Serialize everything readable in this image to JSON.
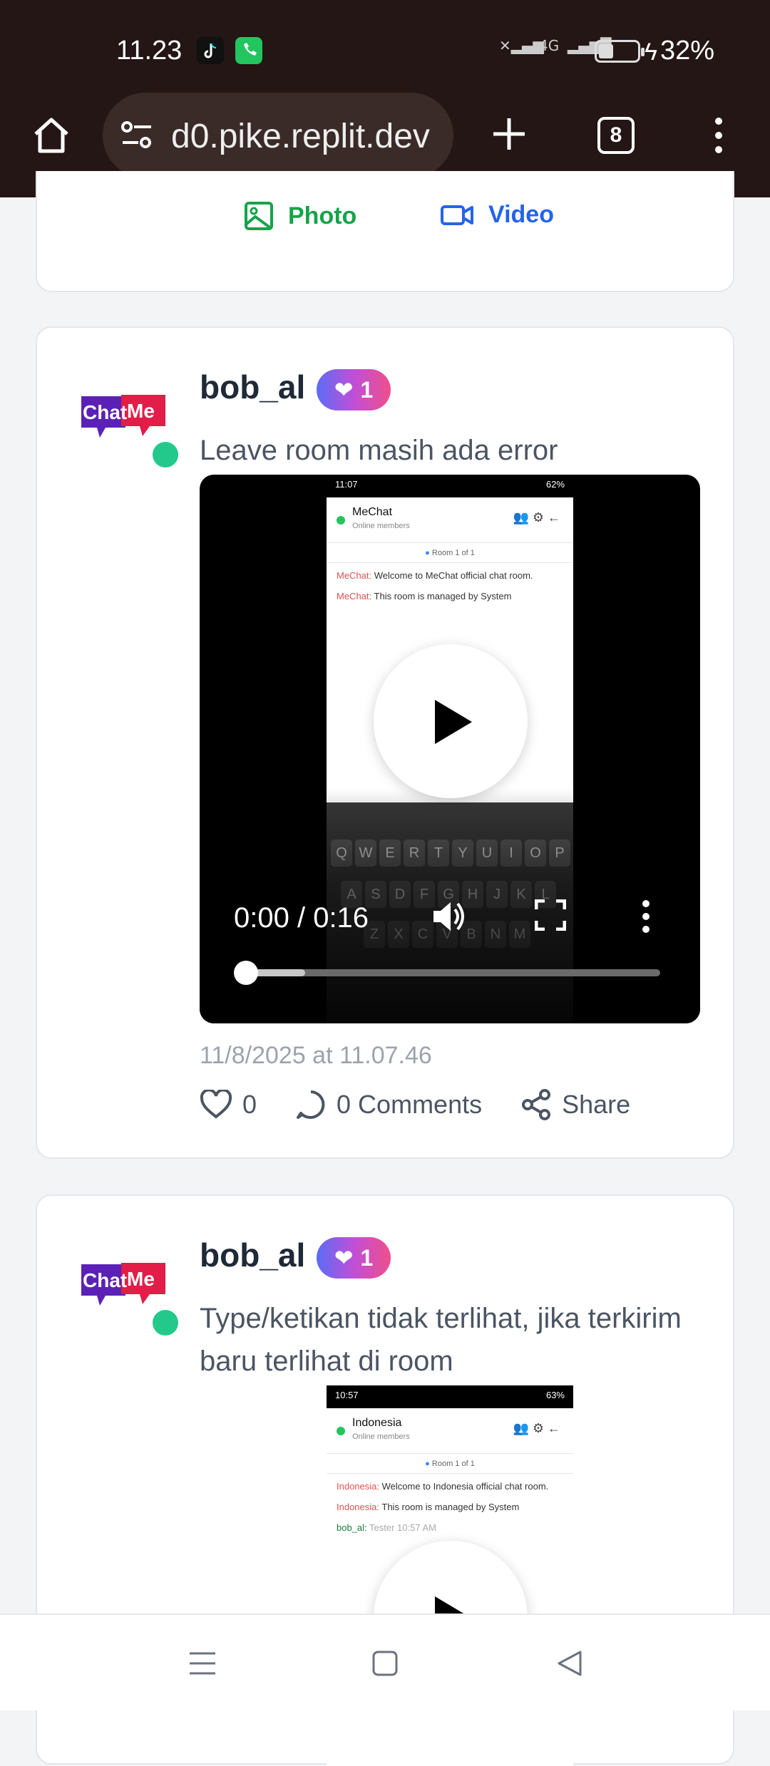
{
  "status_bar": {
    "time": "11.23",
    "network": "4G",
    "battery_pct": "32%"
  },
  "browser": {
    "url": "d0.pike.replit.dev",
    "tab_count": "8"
  },
  "composer": {
    "photo_label": "Photo",
    "video_label": "Video"
  },
  "posts": [
    {
      "username": "bob_al",
      "badge_count": "1",
      "text": "Leave room masih ada error",
      "video": {
        "time": "0:00 / 0:16",
        "progress": 0.0,
        "screenshot": {
          "status_time": "11:07",
          "status_right": "62%",
          "room_name": "MeChat",
          "room_sub": "Online members",
          "room_indicator": "Room 1 of 1",
          "messages": [
            {
              "who": "MeChat:",
              "text": "Welcome to MeChat official chat room."
            },
            {
              "who": "MeChat:",
              "text": "This room is managed by System"
            }
          ],
          "keyboard_row1": [
            "Q",
            "W",
            "E",
            "R",
            "T",
            "Y",
            "U",
            "I",
            "O",
            "P"
          ],
          "keyboard_row2": [
            "A",
            "S",
            "D",
            "F",
            "G",
            "H",
            "J",
            "K",
            "L"
          ],
          "keyboard_row3": [
            "Z",
            "X",
            "C",
            "V",
            "B",
            "N",
            "M"
          ]
        }
      },
      "timestamp": "11/8/2025 at 11.07.46",
      "likes": "0",
      "comments": "0 Comments",
      "share": "Share"
    },
    {
      "username": "bob_al",
      "badge_count": "1",
      "text": "Type/ketikan tidak terlihat, jika terkirim baru terlihat di room",
      "video": {
        "screenshot": {
          "status_time": "10:57",
          "status_right": "63%",
          "room_name": "Indonesia",
          "room_sub": "Online members",
          "room_indicator": "Room 1 of 1",
          "messages": [
            {
              "who": "Indonesia:",
              "text": "Welcome to Indonesia official chat room."
            },
            {
              "who": "Indonesia:",
              "text": "This room is managed by System"
            },
            {
              "who": "bob_al:",
              "text": "Tester 10:57 AM"
            }
          ]
        }
      }
    }
  ],
  "logo_text": "Chat Me",
  "colors": {
    "chrome_bg": "#241614",
    "photo": "#16a34a",
    "video": "#2563eb",
    "online": "#22c98a"
  }
}
